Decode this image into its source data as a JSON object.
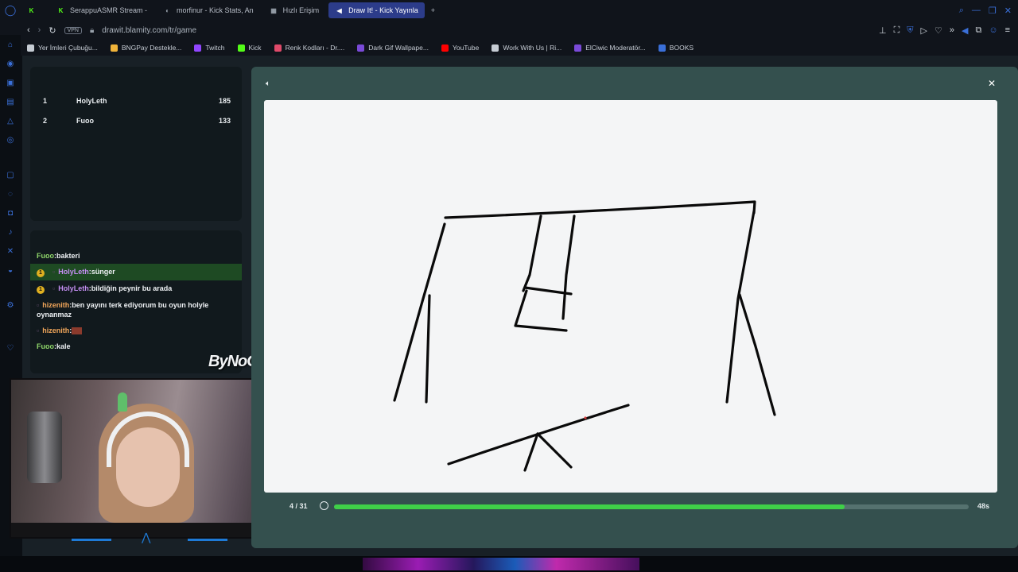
{
  "browser": {
    "tabs": [
      {
        "label": "",
        "icon": "kick-icon",
        "color": "#53fc18"
      },
      {
        "label": "SerappuASMR Stream - ",
        "icon": "kick-icon",
        "color": "#53fc18"
      },
      {
        "label": "morfinur - Kick Stats, An",
        "icon": "stats-icon",
        "color": "#9aa3ad"
      },
      {
        "label": "Hızlı Erişim",
        "icon": "grid-icon",
        "color": "#9aa3ad"
      },
      {
        "label": "Draw It! - Kick Yayınla",
        "icon": "sound-icon",
        "color": "#ffffff",
        "active": true
      }
    ],
    "new_tab": "+",
    "vpn_label": "VPN",
    "url": "drawit.blamity.com/tr/game",
    "bookmarks": [
      {
        "label": "Yer İmleri Çubuğu...",
        "color": "#c6ccd4"
      },
      {
        "label": "BNGPay Destekle...",
        "color": "#f0b33a"
      },
      {
        "label": "Twitch",
        "color": "#9146ff"
      },
      {
        "label": "Kick",
        "color": "#53fc18"
      },
      {
        "label": "Renk Kodları - Dr....",
        "color": "#e04a6a"
      },
      {
        "label": "Dark Gif Wallpape...",
        "color": "#7a4ad8"
      },
      {
        "label": "YouTube",
        "color": "#ff0000"
      },
      {
        "label": "Work With Us | Ri...",
        "color": "#c6ccd4"
      },
      {
        "label": "ElCiwic Moderatör...",
        "color": "#7a4ad8"
      },
      {
        "label": "BOOKS",
        "color": "#3a6fd8"
      }
    ]
  },
  "scoreboard": {
    "rows": [
      {
        "rank": "1",
        "name": "HolyLeth",
        "score": "185"
      },
      {
        "rank": "2",
        "name": "Fuoo",
        "score": "133"
      }
    ]
  },
  "chat": {
    "messages": [
      {
        "user": "Fuoo",
        "text": ":bakteri",
        "color": "green"
      },
      {
        "user": "HolyLeth",
        "text": ":sünger",
        "color": "purple",
        "badge": "1",
        "highlight": true
      },
      {
        "user": "HolyLeth",
        "text": ":bildiğin peynir bu arada",
        "color": "purple",
        "badge": "1"
      },
      {
        "user": "hizenith",
        "text": ":ben yayını terk ediyorum bu oyun holyle oynanmaz",
        "color": "orange"
      },
      {
        "user": "hizenith",
        "text": ":",
        "color": "orange",
        "emote": true
      },
      {
        "user": "Fuoo",
        "text": ":kale",
        "color": "green"
      }
    ]
  },
  "overlay": {
    "text": "ByNoGa"
  },
  "game": {
    "round": "4 / 31",
    "time_left": "48s",
    "progress": 0.805
  },
  "colors": {
    "accent": "#3fd048",
    "game_bg": "#34504e",
    "canvas": "#f4f5f6"
  }
}
